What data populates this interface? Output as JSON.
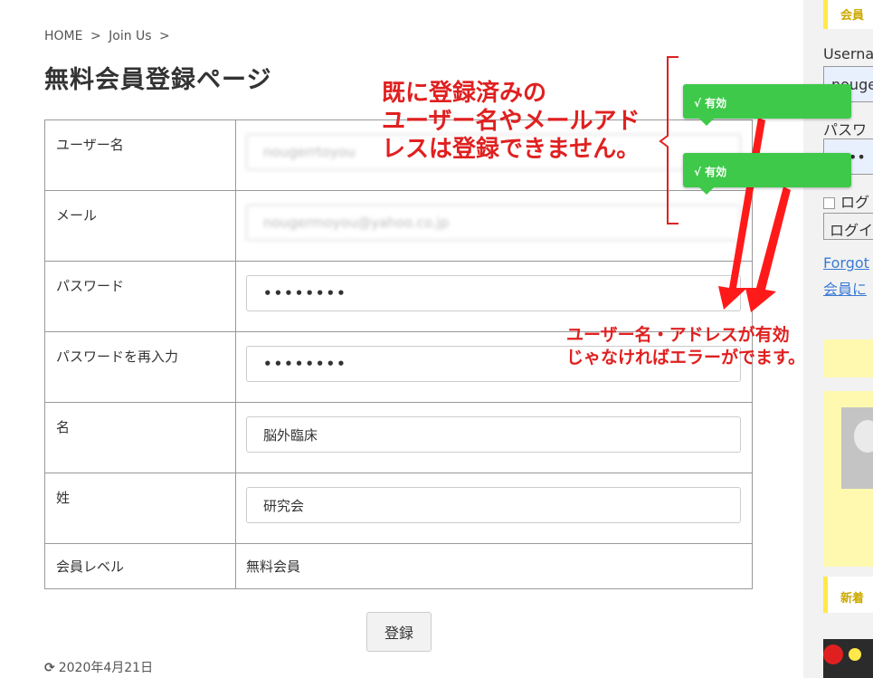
{
  "breadcrumb": {
    "home": "HOME",
    "sep1": ">",
    "current": "Join Us",
    "sep2": ">"
  },
  "page_title": "無料会員登録ページ",
  "form": {
    "username": {
      "label": "ユーザー名",
      "value": "nougerrtoyou"
    },
    "email": {
      "label": "メール",
      "value": "nougermoyou@yahoo.co.jp"
    },
    "password": {
      "label": "パスワード",
      "value": "••••••••"
    },
    "password_confirm": {
      "label": "パスワードを再入力",
      "value": "••••••••"
    },
    "first_name": {
      "label": "名",
      "value": "脳外臨床"
    },
    "last_name": {
      "label": "姓",
      "value": "研究会"
    },
    "level": {
      "label": "会員レベル",
      "value": "無料会員"
    },
    "submit_label": "登録"
  },
  "date": {
    "icon": "refresh-icon",
    "glyph": "⟳",
    "text": "2020年4月21日"
  },
  "annotations": {
    "big_line1": "既に登録済みの",
    "big_line2": "ユーザー名やメールアド",
    "big_line3": "レスは登録できません。",
    "small_line1": "ユーザー名・アドレスが有効",
    "small_line2": "じゃなければエラーがでます。",
    "tooltip1": "√ 有効",
    "tooltip2": "√ 有効",
    "color": "#e02020",
    "tooltip_color": "#3ec94a"
  },
  "sidebar": {
    "heading1": "会員",
    "username_label": "Userna",
    "username_value": "nouge",
    "password_label": "パスワ",
    "password_value": "••••",
    "remember_label": "ログ",
    "login_button": "ログイ",
    "forgot_link": "Forgot",
    "register_link": "会員に",
    "heading2": "新着",
    "accent_color": "#ffe94a"
  }
}
